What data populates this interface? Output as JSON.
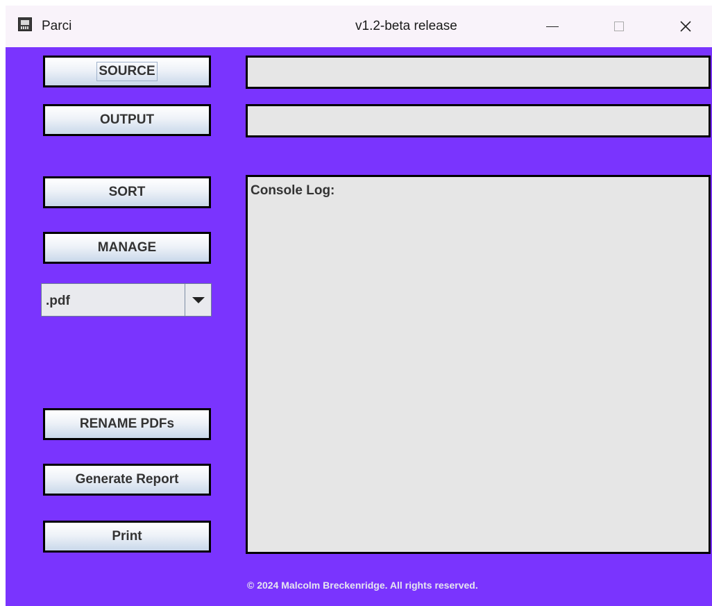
{
  "window": {
    "app_name": "Parci",
    "title": "v1.2-beta release",
    "controls": {
      "minimize": "—",
      "close": "✕"
    }
  },
  "buttons": {
    "source": "SOURCE",
    "output": "OUTPUT",
    "sort": "SORT",
    "manage": "MANAGE",
    "rename": "RENAME PDFs",
    "report": "Generate Report",
    "print": "Print"
  },
  "fields": {
    "source_path": "",
    "output_path": ""
  },
  "filetype": {
    "selected": ".pdf"
  },
  "console": {
    "label": "Console Log:"
  },
  "footer": {
    "copyright": "© 2024 Malcolm Breckenridge. All rights reserved."
  },
  "colors": {
    "background": "#7a34fe",
    "titlebar": "#f9f3fa",
    "field": "#e6e6e6"
  },
  "icons": {
    "app": "computer-icon",
    "dropdown": "triangle-down-icon"
  }
}
